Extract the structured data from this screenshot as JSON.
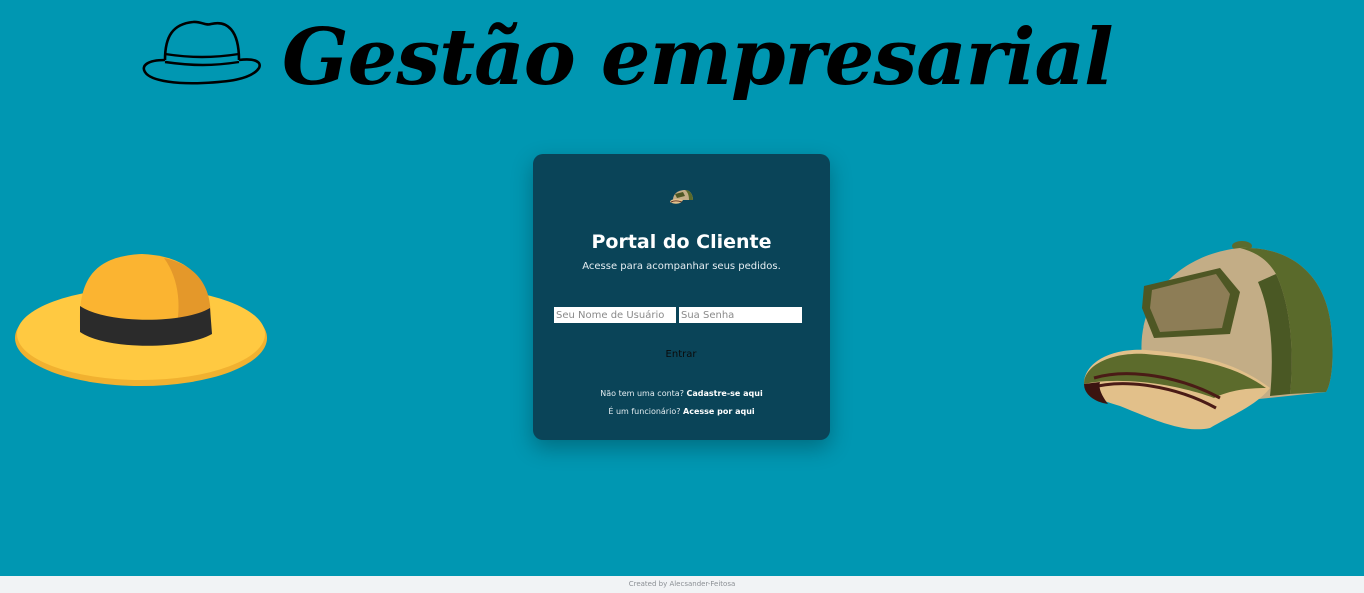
{
  "header": {
    "title": "Gestão empresarial",
    "logo_icon": "fedora-hat-icon"
  },
  "decorations": {
    "left": "yellow-sun-hat-icon",
    "right": "green-baseball-cap-icon"
  },
  "login": {
    "icon": "cap-logo-icon",
    "title": "Portal do Cliente",
    "subtitle": "Acesse para acompanhar seus pedidos.",
    "username_placeholder": "Seu Nome de Usuário",
    "password_placeholder": "Sua Senha",
    "submit_label": "Entrar",
    "signup_prompt": "Não tem uma conta?",
    "signup_link": "Cadastre-se aqui",
    "employee_prompt": "É um funcionário?",
    "employee_link": "Acesse por aqui"
  },
  "footer": {
    "credit": "Created by Alecsander-Feitosa"
  },
  "colors": {
    "background": "#0097b2",
    "card": "#0a4458",
    "footer": "#f1f3f5"
  }
}
